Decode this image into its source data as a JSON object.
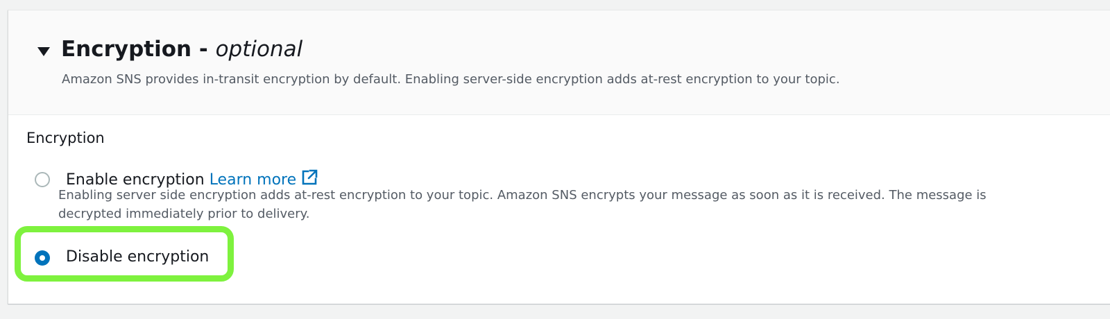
{
  "section": {
    "title": "Encryption - ",
    "title_optional": "optional",
    "description": "Amazon SNS provides in-transit encryption by default. Enabling server-side encryption adds at-rest encryption to your topic."
  },
  "field": {
    "label": "Encryption",
    "options": [
      {
        "label": "Enable encryption",
        "selected": false,
        "link_text": "Learn more",
        "link_icon": "external-link-icon",
        "description": "Enabling server side encryption adds at-rest encryption to your topic. Amazon SNS encrypts your message as soon as it is received. The message is decrypted immediately prior to delivery."
      },
      {
        "label": "Disable encryption",
        "selected": true
      }
    ]
  },
  "colors": {
    "accent": "#0073bb",
    "highlight": "#7ef23e"
  }
}
